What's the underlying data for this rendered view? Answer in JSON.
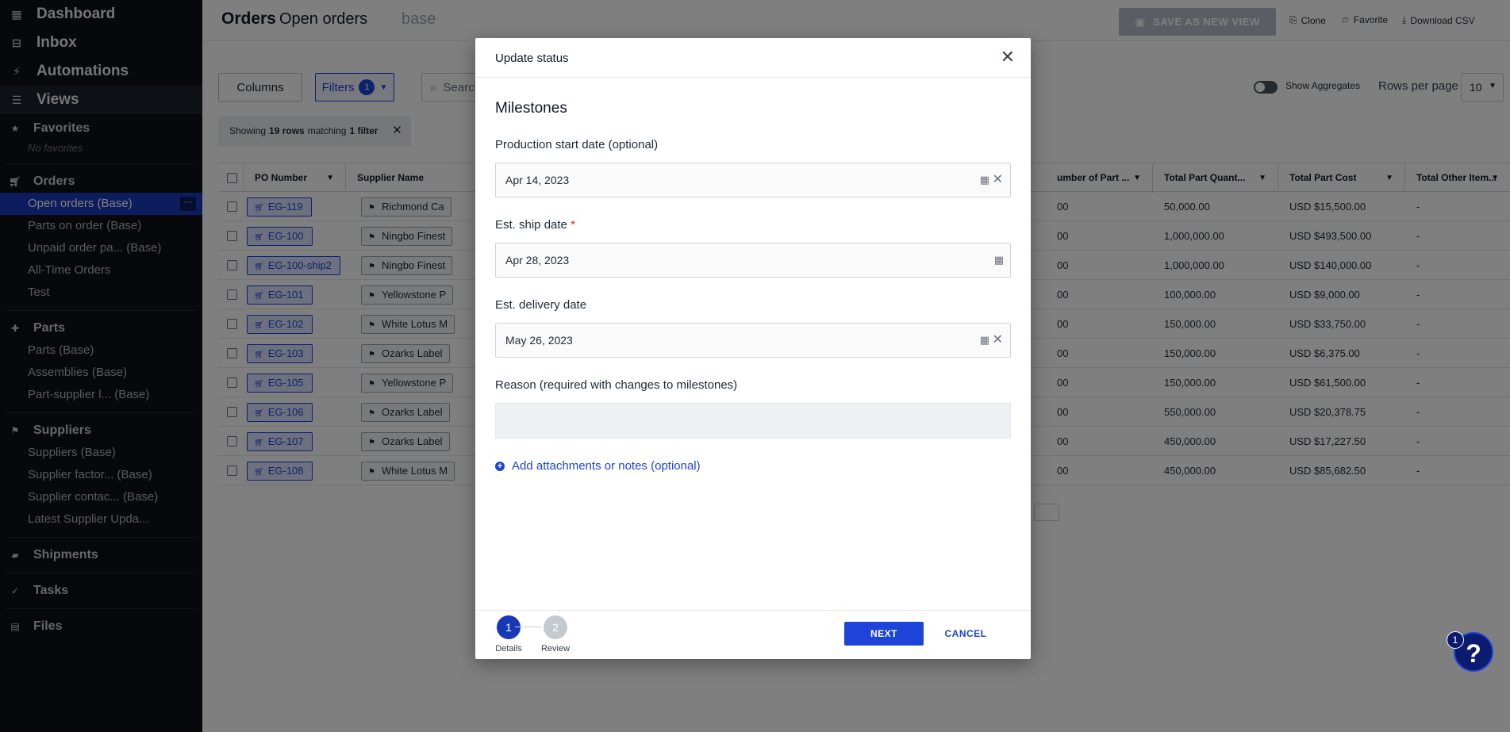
{
  "sidebar": {
    "dashboard": "Dashboard",
    "inbox": "Inbox",
    "automations": "Automations",
    "views": "Views",
    "favorites": {
      "title": "Favorites",
      "empty": "No favorites"
    },
    "orders": {
      "title": "Orders",
      "items": [
        "Open orders (Base)",
        "Parts on order (Base)",
        "Unpaid order pa... (Base)",
        "All-Time Orders",
        "Test"
      ],
      "more": "···"
    },
    "parts": {
      "title": "Parts",
      "items": [
        "Parts (Base)",
        "Assemblies (Base)",
        "Part-supplier l... (Base)"
      ]
    },
    "suppliers": {
      "title": "Suppliers",
      "items": [
        "Suppliers (Base)",
        "Supplier factor... (Base)",
        "Supplier contac... (Base)",
        "Latest Supplier Upda..."
      ]
    },
    "shipments": "Shipments",
    "tasks": "Tasks",
    "files": "Files"
  },
  "header": {
    "crumb": "Orders",
    "view": "Open orders",
    "tag": "base",
    "save_as_new_view": "SAVE AS NEW VIEW",
    "clone": "Clone",
    "favorite": "Favorite",
    "download_csv": "Download CSV"
  },
  "toolbar": {
    "columns": "Columns",
    "filters": "Filters",
    "filter_count": "1",
    "search_placeholder": "Search",
    "show_aggregates": "Show Aggregates",
    "rows_per_page_label": "Rows per page",
    "rows_per_page": "10"
  },
  "filter_summary": {
    "prefix": "Showing",
    "rows": "19 rows",
    "middle": "matching",
    "filters": "1 filter",
    "clear": "✕"
  },
  "table": {
    "headers": {
      "po": "PO Number",
      "supplier": "Supplier Name",
      "num_parts": "umber of Part ...",
      "qty": "Total Part Quant...",
      "cost": "Total Part Cost",
      "other": "Total Other Item..."
    },
    "rows": [
      {
        "po": "EG-119",
        "supplier": "Richmond Ca",
        "num": "00",
        "qty": "50,000.00",
        "cost": "USD $15,500.00",
        "other": "-"
      },
      {
        "po": "EG-100",
        "supplier": "Ningbo Finest",
        "num": "00",
        "qty": "1,000,000.00",
        "cost": "USD $493,500.00",
        "other": "-"
      },
      {
        "po": "EG-100-ship2",
        "supplier": "Ningbo Finest",
        "num": "00",
        "qty": "1,000,000.00",
        "cost": "USD $140,000.00",
        "other": "-"
      },
      {
        "po": "EG-101",
        "supplier": "Yellowstone P",
        "num": "00",
        "qty": "100,000.00",
        "cost": "USD $9,000.00",
        "other": "-"
      },
      {
        "po": "EG-102",
        "supplier": "White Lotus M",
        "num": "00",
        "qty": "150,000.00",
        "cost": "USD $33,750.00",
        "other": "-"
      },
      {
        "po": "EG-103",
        "supplier": "Ozarks Label",
        "num": "00",
        "qty": "150,000.00",
        "cost": "USD $6,375.00",
        "other": "-"
      },
      {
        "po": "EG-105",
        "supplier": "Yellowstone P",
        "num": "00",
        "qty": "150,000.00",
        "cost": "USD $61,500.00",
        "other": "-"
      },
      {
        "po": "EG-106",
        "supplier": "Ozarks Label",
        "num": "00",
        "qty": "550,000.00",
        "cost": "USD $20,378.75",
        "other": "-"
      },
      {
        "po": "EG-107",
        "supplier": "Ozarks Label",
        "num": "00",
        "qty": "450,000.00",
        "cost": "USD $17,227.50",
        "other": "-"
      },
      {
        "po": "EG-108",
        "supplier": "White Lotus M",
        "num": "00",
        "qty": "450,000.00",
        "cost": "USD $85,682.50",
        "other": "-"
      }
    ]
  },
  "modal": {
    "title": "Update status",
    "section": "Milestones",
    "production_start": {
      "label": "Production start date (optional)",
      "value": "Apr 14, 2023"
    },
    "ship_date": {
      "label": "Est. ship date",
      "required_mark": "*",
      "value": "Apr 28, 2023"
    },
    "delivery_date": {
      "label": "Est. delivery date",
      "value": "May 26, 2023"
    },
    "reason": {
      "label": "Reason (required with changes to milestones)",
      "value": ""
    },
    "add_attachments": "Add attachments or notes (optional)",
    "steps": [
      {
        "num": "1",
        "label": "Details"
      },
      {
        "num": "2",
        "label": "Review"
      }
    ],
    "next": "NEXT",
    "cancel": "CANCEL"
  },
  "help": {
    "label": "?",
    "badge": "1"
  },
  "colors": {
    "sidebar_bg": "#0d1117",
    "accent": "#1d43d8",
    "active_item": "#1838b8",
    "overlay": "rgba(0,0,0,0.5)"
  }
}
